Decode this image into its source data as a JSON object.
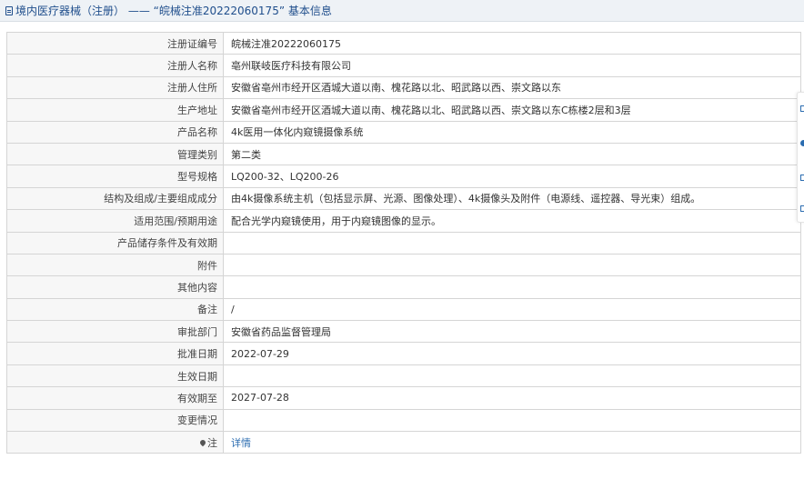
{
  "header": {
    "title": "境内医疗器械（注册） —— “皖械注准20222060175” 基本信息"
  },
  "rows": [
    {
      "label": "注册证编号",
      "value": "皖械注准20222060175"
    },
    {
      "label": "注册人名称",
      "value": "亳州联岐医疗科技有限公司"
    },
    {
      "label": "注册人住所",
      "value": "安徽省亳州市经开区酒城大道以南、槐花路以北、昭武路以西、崇文路以东"
    },
    {
      "label": "生产地址",
      "value": "安徽省亳州市经开区酒城大道以南、槐花路以北、昭武路以西、崇文路以东C栋楼2层和3层"
    },
    {
      "label": "产品名称",
      "value": "4k医用一体化内窥镜摄像系统"
    },
    {
      "label": "管理类别",
      "value": "第二类"
    },
    {
      "label": "型号规格",
      "value": "LQ200-32、LQ200-26"
    },
    {
      "label": "结构及组成/主要组成成分",
      "value": "由4k摄像系统主机（包括显示屏、光源、图像处理）、4k摄像头及附件（电源线、遥控器、导光束）组成。"
    },
    {
      "label": "适用范围/预期用途",
      "value": "配合光学内窥镜使用，用于内窥镜图像的显示。"
    },
    {
      "label": "产品储存条件及有效期",
      "value": ""
    },
    {
      "label": "附件",
      "value": ""
    },
    {
      "label": "其他内容",
      "value": ""
    },
    {
      "label": "备注",
      "value": "/"
    },
    {
      "label": "审批部门",
      "value": "安徽省药品监督管理局"
    },
    {
      "label": "批准日期",
      "value": "2022-07-29"
    },
    {
      "label": "生效日期",
      "value": ""
    },
    {
      "label": "有效期至",
      "value": "2027-07-28"
    },
    {
      "label": "变更情况",
      "value": ""
    }
  ],
  "note": {
    "label": "注",
    "icon": "pin-icon",
    "link_text": "详情"
  }
}
